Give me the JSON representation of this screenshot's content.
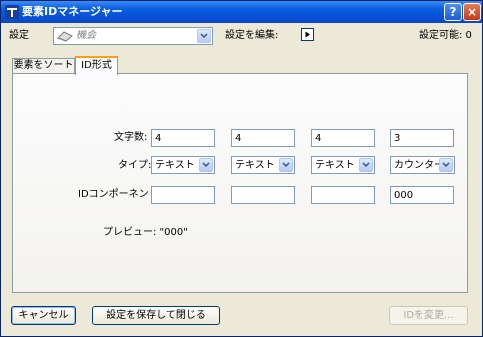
{
  "window": {
    "title": "要素IDマネージャー",
    "help_label": "?",
    "close_label": "×"
  },
  "settings_row": {
    "label": "設定",
    "combo_value": "機会",
    "edit_label": "設定を編集:",
    "available_label": "設定可能: 0"
  },
  "tabs": [
    {
      "label": "要素をソート",
      "selected": false
    },
    {
      "label": "ID形式",
      "selected": true
    }
  ],
  "form": {
    "chars_label": "文字数:",
    "type_label": "タイプ:",
    "component_label": "IDコンポーネント:",
    "preview_label": "プレビュー: \"000\"",
    "columns": [
      {
        "chars": "4",
        "type": "テキスト",
        "component": ""
      },
      {
        "chars": "4",
        "type": "テキスト",
        "component": ""
      },
      {
        "chars": "4",
        "type": "テキスト",
        "component": ""
      },
      {
        "chars": "3",
        "type": "カウンター",
        "component": "000"
      }
    ]
  },
  "footer": {
    "cancel_label": "キャンセル",
    "save_close_label": "設定を保存して閉じる",
    "change_id_label": "IDを変更..."
  }
}
